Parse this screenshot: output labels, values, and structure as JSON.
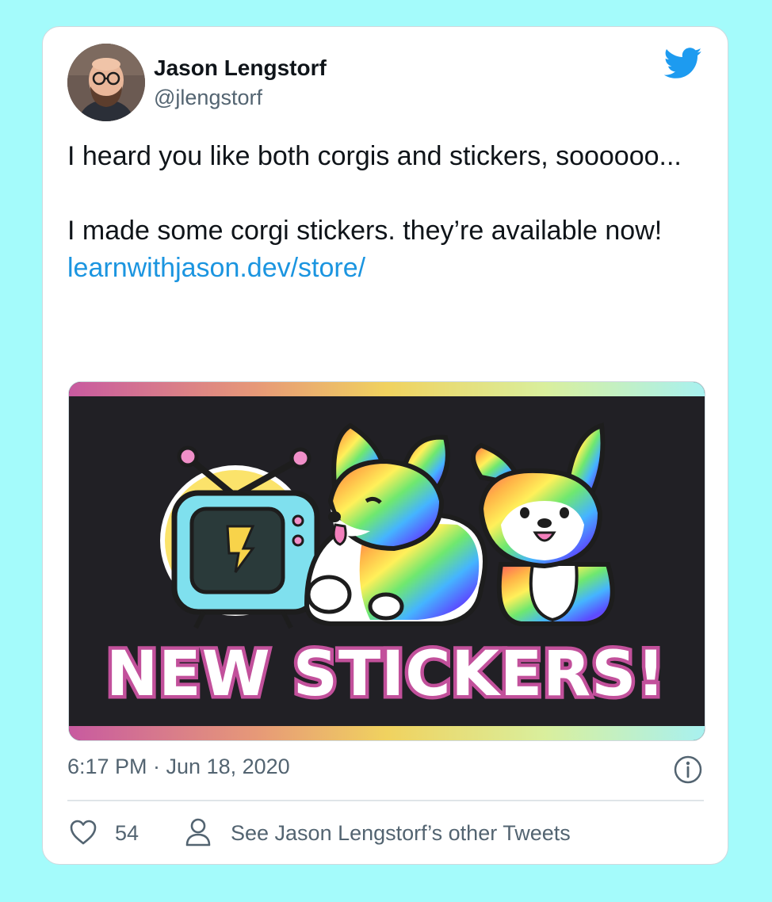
{
  "author": {
    "name": "Jason Lengstorf",
    "handle": "@jlengstorf"
  },
  "tweet": {
    "line1": "I heard you like both corgis and stickers, soooooo...",
    "line2": "I made some corgi stickers. they’re available now!",
    "link": "learnwithjason.dev/store/",
    "timestamp": "6:17 PM · Jun 18, 2020"
  },
  "media": {
    "headline": "NEW STICKERS!"
  },
  "actions": {
    "like_count": "54",
    "other_tweets_label": "See Jason Lengstorf’s other Tweets"
  },
  "icons": {
    "brand": "twitter-bird-icon",
    "info": "info-icon",
    "like": "heart-icon",
    "profile": "person-icon"
  },
  "colors": {
    "page_background": "#a4fbfb",
    "link": "#1b95e0",
    "twitter_blue": "#1d9bf0",
    "secondary_text": "#536471",
    "headline_pink": "#c2509b"
  }
}
